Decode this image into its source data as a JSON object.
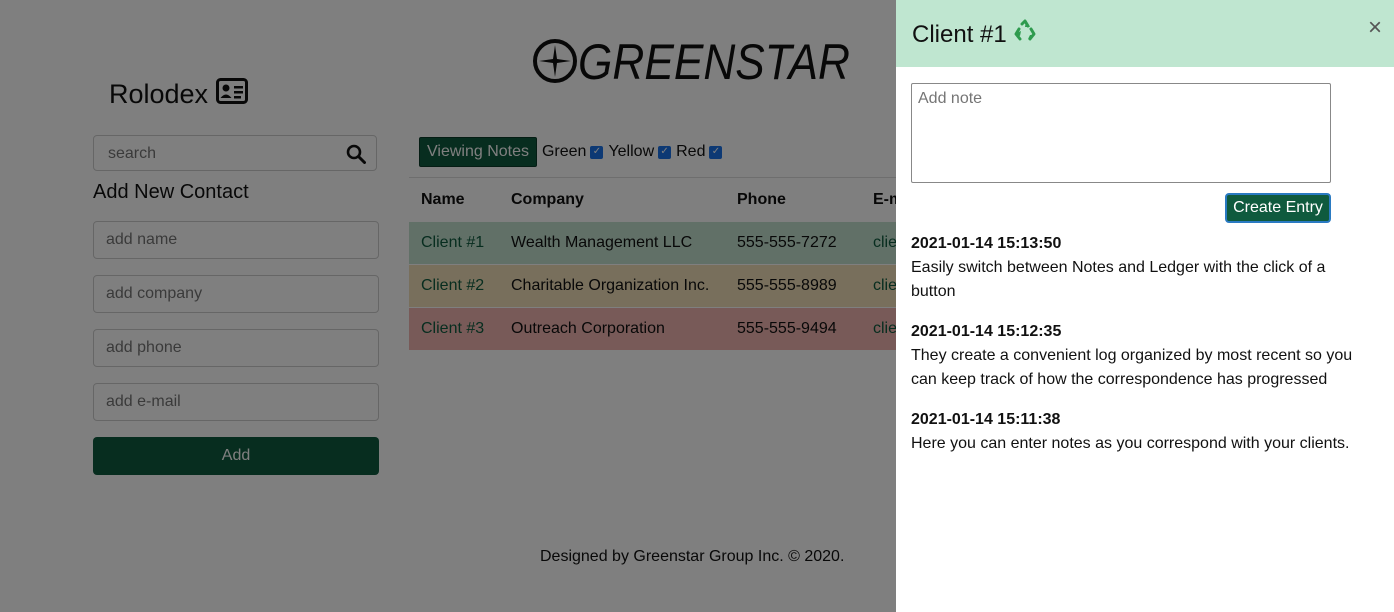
{
  "brand": {
    "logo_text": "GREENSTAR"
  },
  "rolodex": {
    "title": "Rolodex",
    "search": {
      "placeholder": "search"
    },
    "add_new_title": "Add New Contact",
    "fields": {
      "name": "add name",
      "company": "add company",
      "phone": "add phone",
      "email": "add e-mail"
    },
    "add_button": "Add"
  },
  "filters": {
    "viewing_notes": "Viewing Notes",
    "green": "Green",
    "yellow": "Yellow",
    "red": "Red"
  },
  "table": {
    "headers": {
      "name": "Name",
      "company": "Company",
      "phone": "Phone",
      "email": "E-m"
    },
    "rows": [
      {
        "name": "Client #1",
        "company": "Wealth Management LLC",
        "phone": "555-555-7272",
        "email": "clie",
        "color": "#c2e0cf"
      },
      {
        "name": "Client #2",
        "company": "Charitable Organization Inc.",
        "phone": "555-555-8989",
        "email": "clie",
        "color": "#f0dfb9"
      },
      {
        "name": "Client #3",
        "company": "Outreach Corporation",
        "phone": "555-555-9494",
        "email": "clie",
        "color": "#f1b5b1"
      }
    ]
  },
  "footer": "Designed by Greenstar Group Inc. © 2020.",
  "panel": {
    "title": "Client #1",
    "title_icon": "recycle-icon",
    "close": "×",
    "note_placeholder": "Add note",
    "create_button": "Create Entry",
    "entries": [
      {
        "ts": "2021-01-14 15:13:50",
        "text": "Easily switch between Notes and Ledger with the click of a button"
      },
      {
        "ts": "2021-01-14 15:12:35",
        "text": "They create a convenient log organized by most recent so you can keep track of how the correspondence has progressed"
      },
      {
        "ts": "2021-01-14 15:11:38",
        "text": "Here you can enter notes as you correspond with your clients."
      }
    ]
  },
  "colors": {
    "primary": "#0f5a3e",
    "panel_header": "#bfe6d0",
    "checkbox": "#1a73e8"
  }
}
